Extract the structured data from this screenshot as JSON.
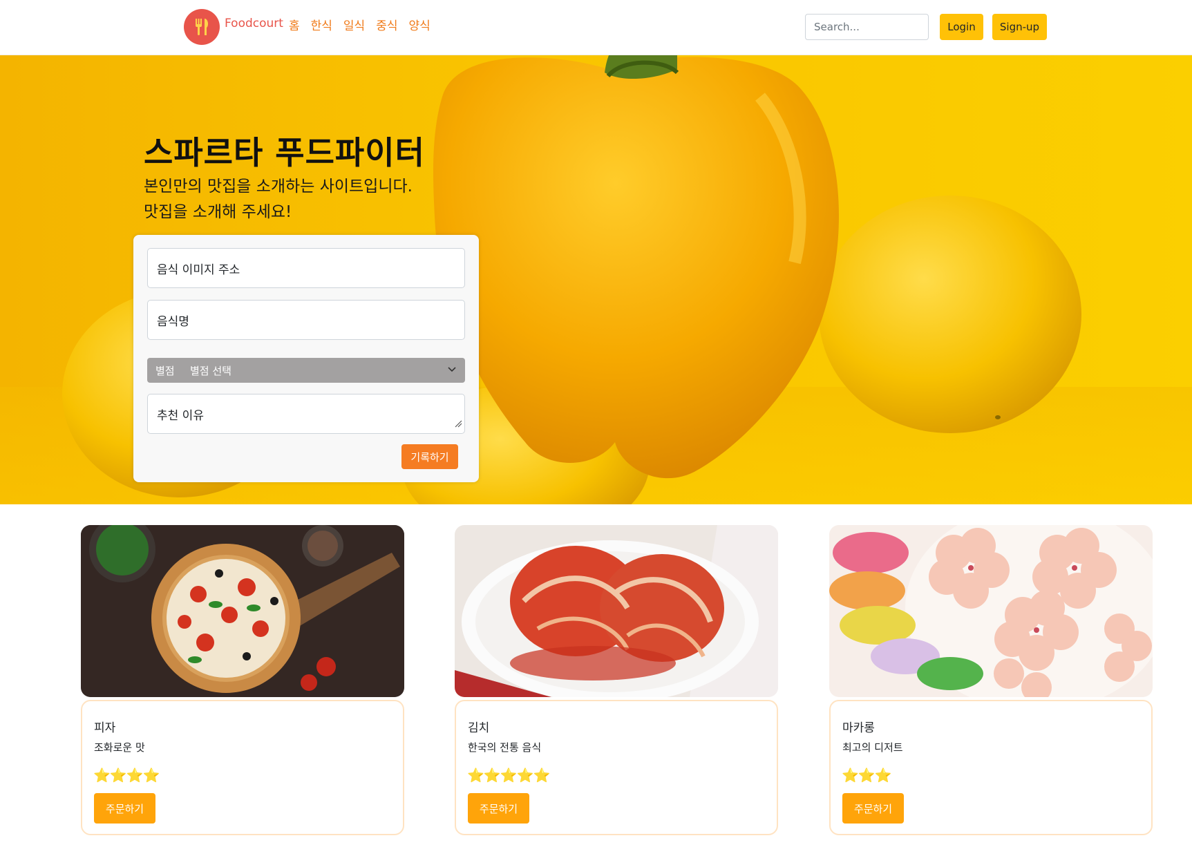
{
  "nav": {
    "brand": "Foodcourt",
    "logo_icon": "utensils-icon",
    "links": [
      "홈",
      "한식",
      "일식",
      "중식",
      "양식"
    ],
    "search_placeholder": "Search...",
    "login_label": "Login",
    "signup_label": "Sign-up"
  },
  "hero": {
    "title": "스파르타 푸드파이터",
    "subtitle_line1": "본인만의 맛집을 소개하는 사이트입니다.",
    "subtitle_line2": "맛집을 소개해 주세요!"
  },
  "form": {
    "image_url_placeholder": "음식 이미지 주소",
    "food_name_placeholder": "음식명",
    "rating_label": "별점",
    "rating_value": "별점 선택",
    "reason_placeholder": "추천 이유",
    "submit_label": "기록하기"
  },
  "colors": {
    "brand": "#e8544a",
    "nav_link": "#f07a18",
    "accent_yellow": "#ffc107",
    "order_button": "#ffa40a",
    "submit_button": "#f57c22"
  },
  "cards": [
    {
      "title": "피자",
      "desc": "조화로운 맛",
      "stars": 4,
      "order_label": "주문하기"
    },
    {
      "title": "김치",
      "desc": "한국의 전통 음식",
      "stars": 5,
      "order_label": "주문하기"
    },
    {
      "title": "마카롱",
      "desc": "최고의 디저트",
      "stars": 3,
      "order_label": "주문하기"
    }
  ]
}
